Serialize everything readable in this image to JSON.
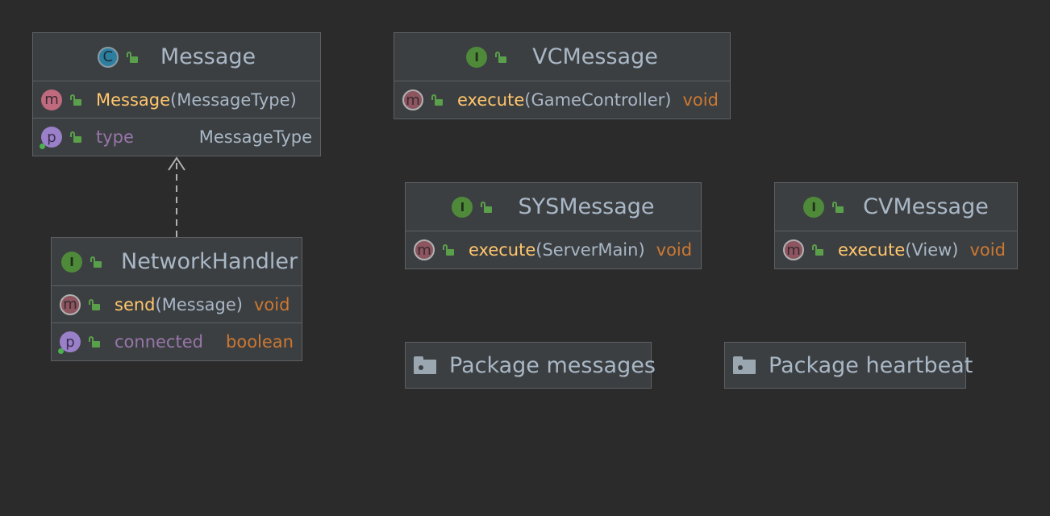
{
  "classes": {
    "message": {
      "kind": "C",
      "name": "Message",
      "constructor": {
        "name": "Message",
        "params": "(MessageType)"
      },
      "property": {
        "name": "type",
        "type": "MessageType"
      }
    },
    "network_handler": {
      "kind": "I",
      "name": "NetworkHandler",
      "method": {
        "name": "send",
        "params": "(Message)",
        "returns": "void"
      },
      "property": {
        "name": "connected",
        "type": "boolean"
      }
    },
    "vc_message": {
      "kind": "I",
      "name": "VCMessage",
      "method": {
        "name": "execute",
        "params": "(GameController)",
        "returns": "void"
      }
    },
    "sys_message": {
      "kind": "I",
      "name": "SYSMessage",
      "method": {
        "name": "execute",
        "params": "(ServerMain)",
        "returns": "void"
      }
    },
    "cv_message": {
      "kind": "I",
      "name": "CVMessage",
      "method": {
        "name": "execute",
        "params": "(View)",
        "returns": "void"
      }
    }
  },
  "badges": {
    "method": "m",
    "property": "p"
  },
  "packages": {
    "messages": "Package messages",
    "heartbeat": "Package heartbeat"
  },
  "icons": {
    "class": "class-icon",
    "interface": "interface-icon",
    "method": "method-icon",
    "property": "property-icon",
    "visibility": "public-lock-icon",
    "package": "folder-icon"
  },
  "relations": [
    {
      "from": "NetworkHandler",
      "to": "Message",
      "style": "dashed-open-arrow"
    }
  ],
  "colors": {
    "background": "#2b2b2b",
    "node": "#3c3f41",
    "border": "#5e6163",
    "method_name": "#ffc66d",
    "keyword": "#cc7832",
    "property_name": "#9876aa",
    "text": "#a9b7c6"
  }
}
